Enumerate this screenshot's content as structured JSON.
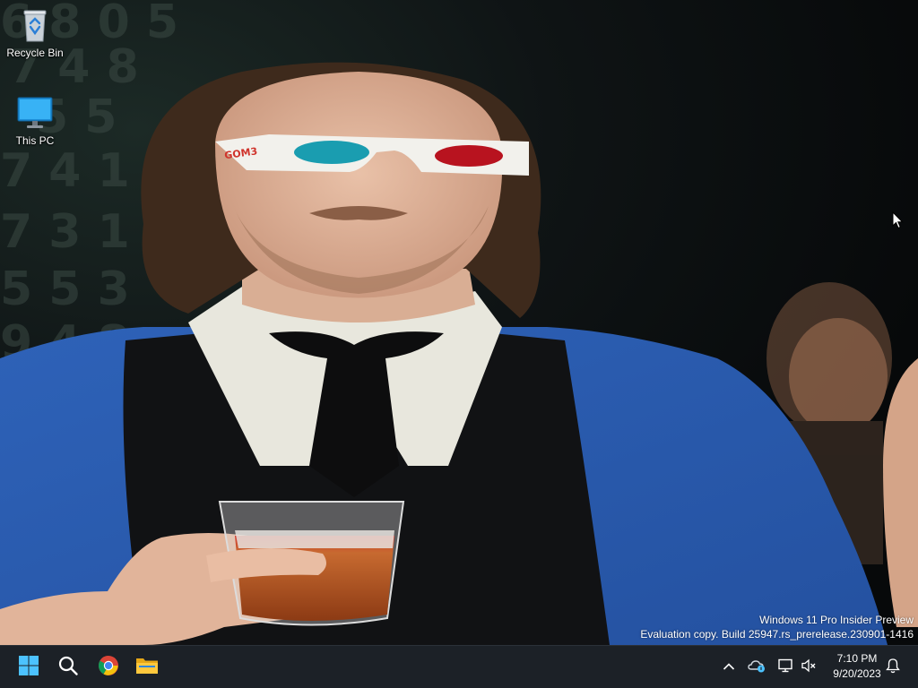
{
  "desktop": {
    "icons": [
      {
        "label": "Recycle Bin",
        "icon": "recycle-bin-icon"
      },
      {
        "label": "This PC",
        "icon": "monitor-icon"
      }
    ],
    "wallpaper_bg_digits": [
      "6 8 0 5",
      "7 4 8",
      "5 5",
      "7 4 1",
      "7 3 1",
      "5 5 3",
      "9 4 8"
    ]
  },
  "watermark": {
    "line1": "Windows 11 Pro Insider Preview",
    "line2": "Evaluation copy. Build 25947.rs_prerelease.230901-1416"
  },
  "taskbar": {
    "pinned": [
      {
        "name": "start-button",
        "icon": "windows-logo-icon"
      },
      {
        "name": "search-button",
        "icon": "search-icon"
      },
      {
        "name": "chrome-button",
        "icon": "chrome-icon"
      },
      {
        "name": "file-explorer-button",
        "icon": "folder-icon"
      }
    ],
    "tray": {
      "icons": [
        "chevron-up-icon",
        "onedrive-icon",
        "network-icon",
        "volume-muted-icon",
        "notification-bell-icon"
      ],
      "time": "7:10 PM",
      "date": "9/20/2023"
    },
    "colors": {
      "background": "#1c2127",
      "start_blue": "#4cc2ff"
    }
  }
}
